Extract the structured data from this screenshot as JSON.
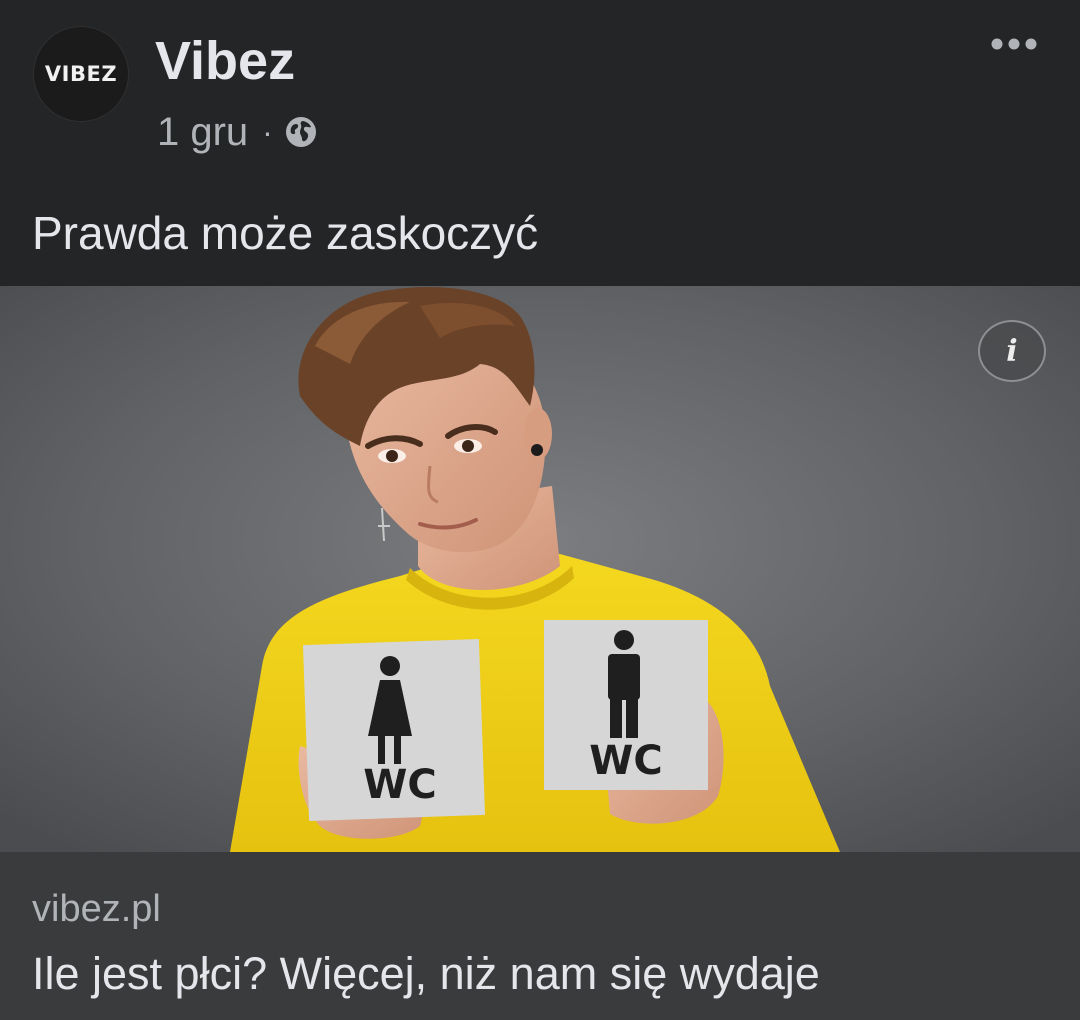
{
  "post": {
    "avatar_text": "VIBEZ",
    "page_name": "Vibez",
    "date": "1 gru",
    "separator": "·",
    "privacy_icon": "globe-icon",
    "more_icon": "more-horizontal-icon",
    "text": "Prawda może zaskoczyć"
  },
  "image": {
    "info_icon": "info-icon",
    "info_label": "i",
    "sign_left_text": "WC",
    "sign_right_text": "WC"
  },
  "link": {
    "domain": "vibez.pl",
    "title": "Ile jest płci? Więcej, niż nam się wydaje"
  },
  "colors": {
    "background": "#242526",
    "link_card": "#3a3b3c",
    "text_primary": "#e4e6eb",
    "text_secondary": "#b0b3b8",
    "shirt_yellow": "#f0d21c"
  }
}
